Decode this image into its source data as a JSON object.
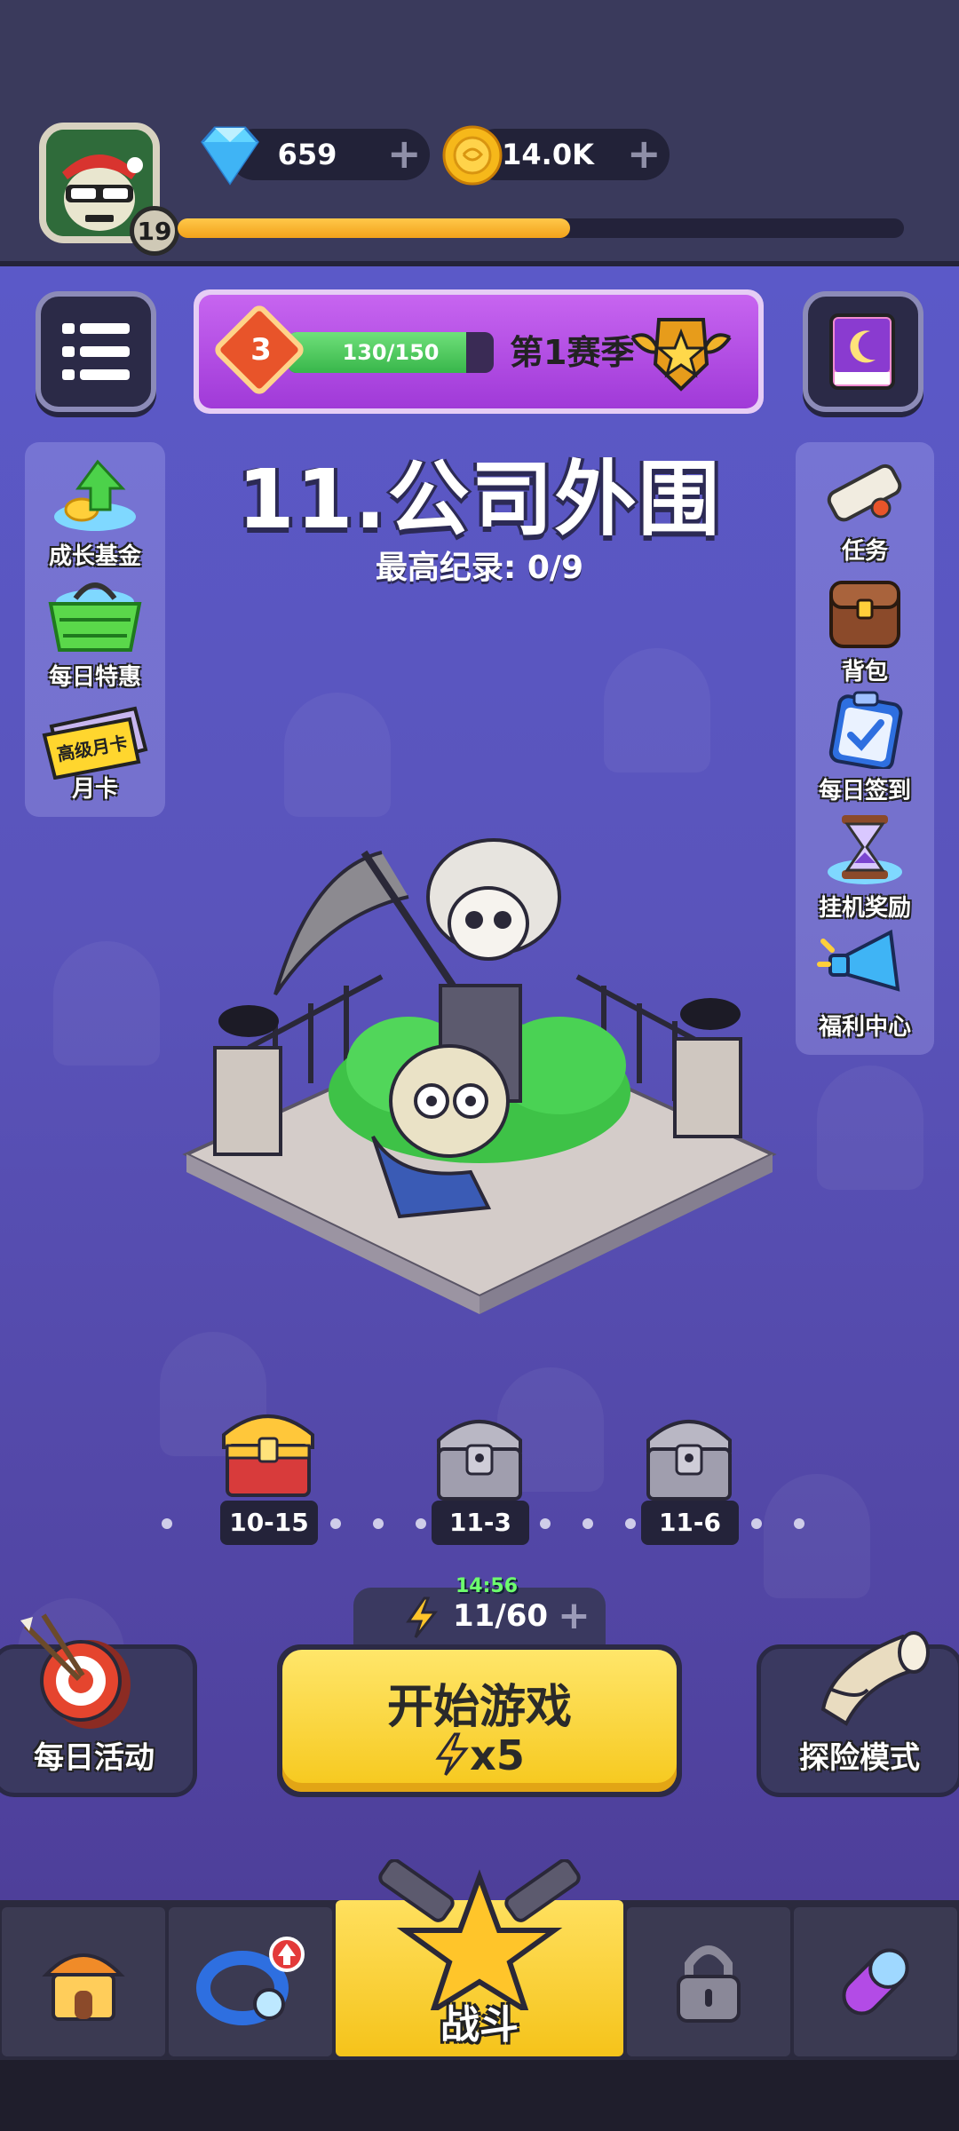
{
  "player": {
    "level": "19",
    "xp_fraction": 0.54
  },
  "currency": {
    "gems": "659",
    "gold": "14.0K"
  },
  "season": {
    "rank": "3",
    "progress": "130/150",
    "progress_fraction": 0.867,
    "label": "第1赛季"
  },
  "stage": {
    "title": "11.公司外围",
    "best_record": "最高纪录: 0/9"
  },
  "left_menu": [
    {
      "label": "成长基金",
      "icon": "growth-fund-icon"
    },
    {
      "label": "每日特惠",
      "icon": "shopping-basket-icon"
    },
    {
      "label": "高级月卡",
      "sub": "月卡",
      "icon": "monthly-card-icon"
    }
  ],
  "right_menu": [
    {
      "label": "任务",
      "icon": "scroll-icon"
    },
    {
      "label": "背包",
      "icon": "backpack-icon"
    },
    {
      "label": "每日签到",
      "icon": "clipboard-check-icon"
    },
    {
      "label": "挂机奖励",
      "icon": "hourglass-icon"
    },
    {
      "label": "福利中心",
      "icon": "megaphone-icon"
    }
  ],
  "chests": [
    {
      "label": "10-15",
      "state": "gold"
    },
    {
      "label": "11-3",
      "state": "locked"
    },
    {
      "label": "11-6",
      "state": "locked"
    }
  ],
  "energy": {
    "timer": "14:56",
    "value": "11/60"
  },
  "start_button": {
    "label": "开始游戏",
    "cost": "x5"
  },
  "side_buttons": {
    "daily": "每日活动",
    "explore": "探险模式"
  },
  "nav": {
    "active_label": "战斗"
  },
  "colors": {
    "accent_yellow": "#f6c81c",
    "season_purple": "#b04be2",
    "bg_purple": "#5a54bb"
  }
}
